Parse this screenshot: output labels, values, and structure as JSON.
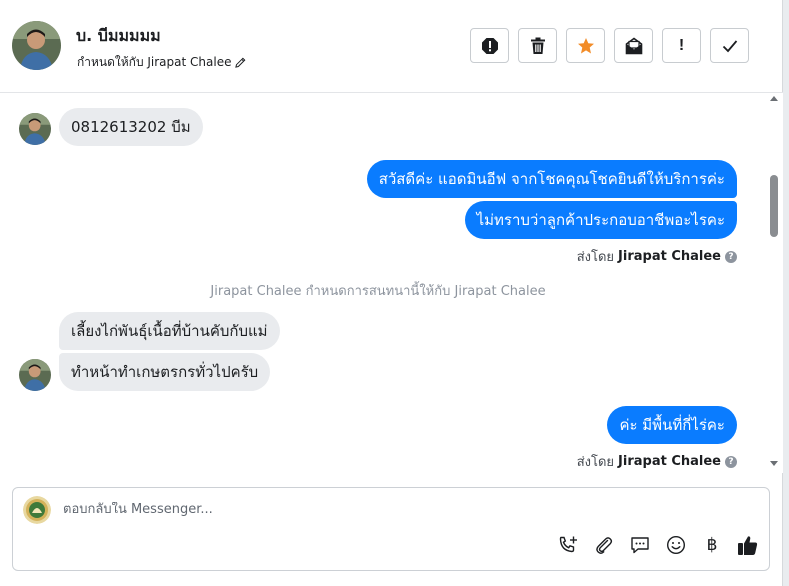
{
  "header": {
    "name": "บ. บีมมมมม",
    "assigned_text": "กำหนดให้กับ Jirapat Chalee"
  },
  "toolbar": {
    "buttons": [
      "mark-spam",
      "delete",
      "star",
      "mark-unread",
      "follow-up",
      "done"
    ],
    "followup_label": "!"
  },
  "messages": {
    "in_1": "0812613202 บีม",
    "out_1": "สวัสดีค่ะ แอดมินอีฟ จากโชคคุณโชคยินดีให้บริการค่ะ",
    "out_2": "ไม่ทราบว่าลูกค้าประกอบอาชีพอะไรคะ",
    "sentby_1_prefix": "ส่งโดย",
    "sentby_1_name": "Jirapat Chalee",
    "system_note": "Jirapat Chalee กำหนดการสนทนานี้ให้กับ Jirapat Chalee",
    "in_2": "เลี้ยงไก่พันธุ์เนื้อที่บ้านคับกับแม่",
    "in_3": "ทำหน้าทำเกษตรกรทั่วไปครับ",
    "out_3": "ค่ะ มีพื้นที่กี่ไร่คะ",
    "sentby_2_prefix": "ส่งโดย",
    "sentby_2_name": "Jirapat Chalee",
    "help_glyph": "?"
  },
  "composer": {
    "placeholder": "ตอบกลับใน Messenger...",
    "currency_glyph": "฿"
  },
  "colors": {
    "outgoing_bubble": "#0a7cff",
    "incoming_bubble": "#e9ebee",
    "star": "#f28c28"
  }
}
